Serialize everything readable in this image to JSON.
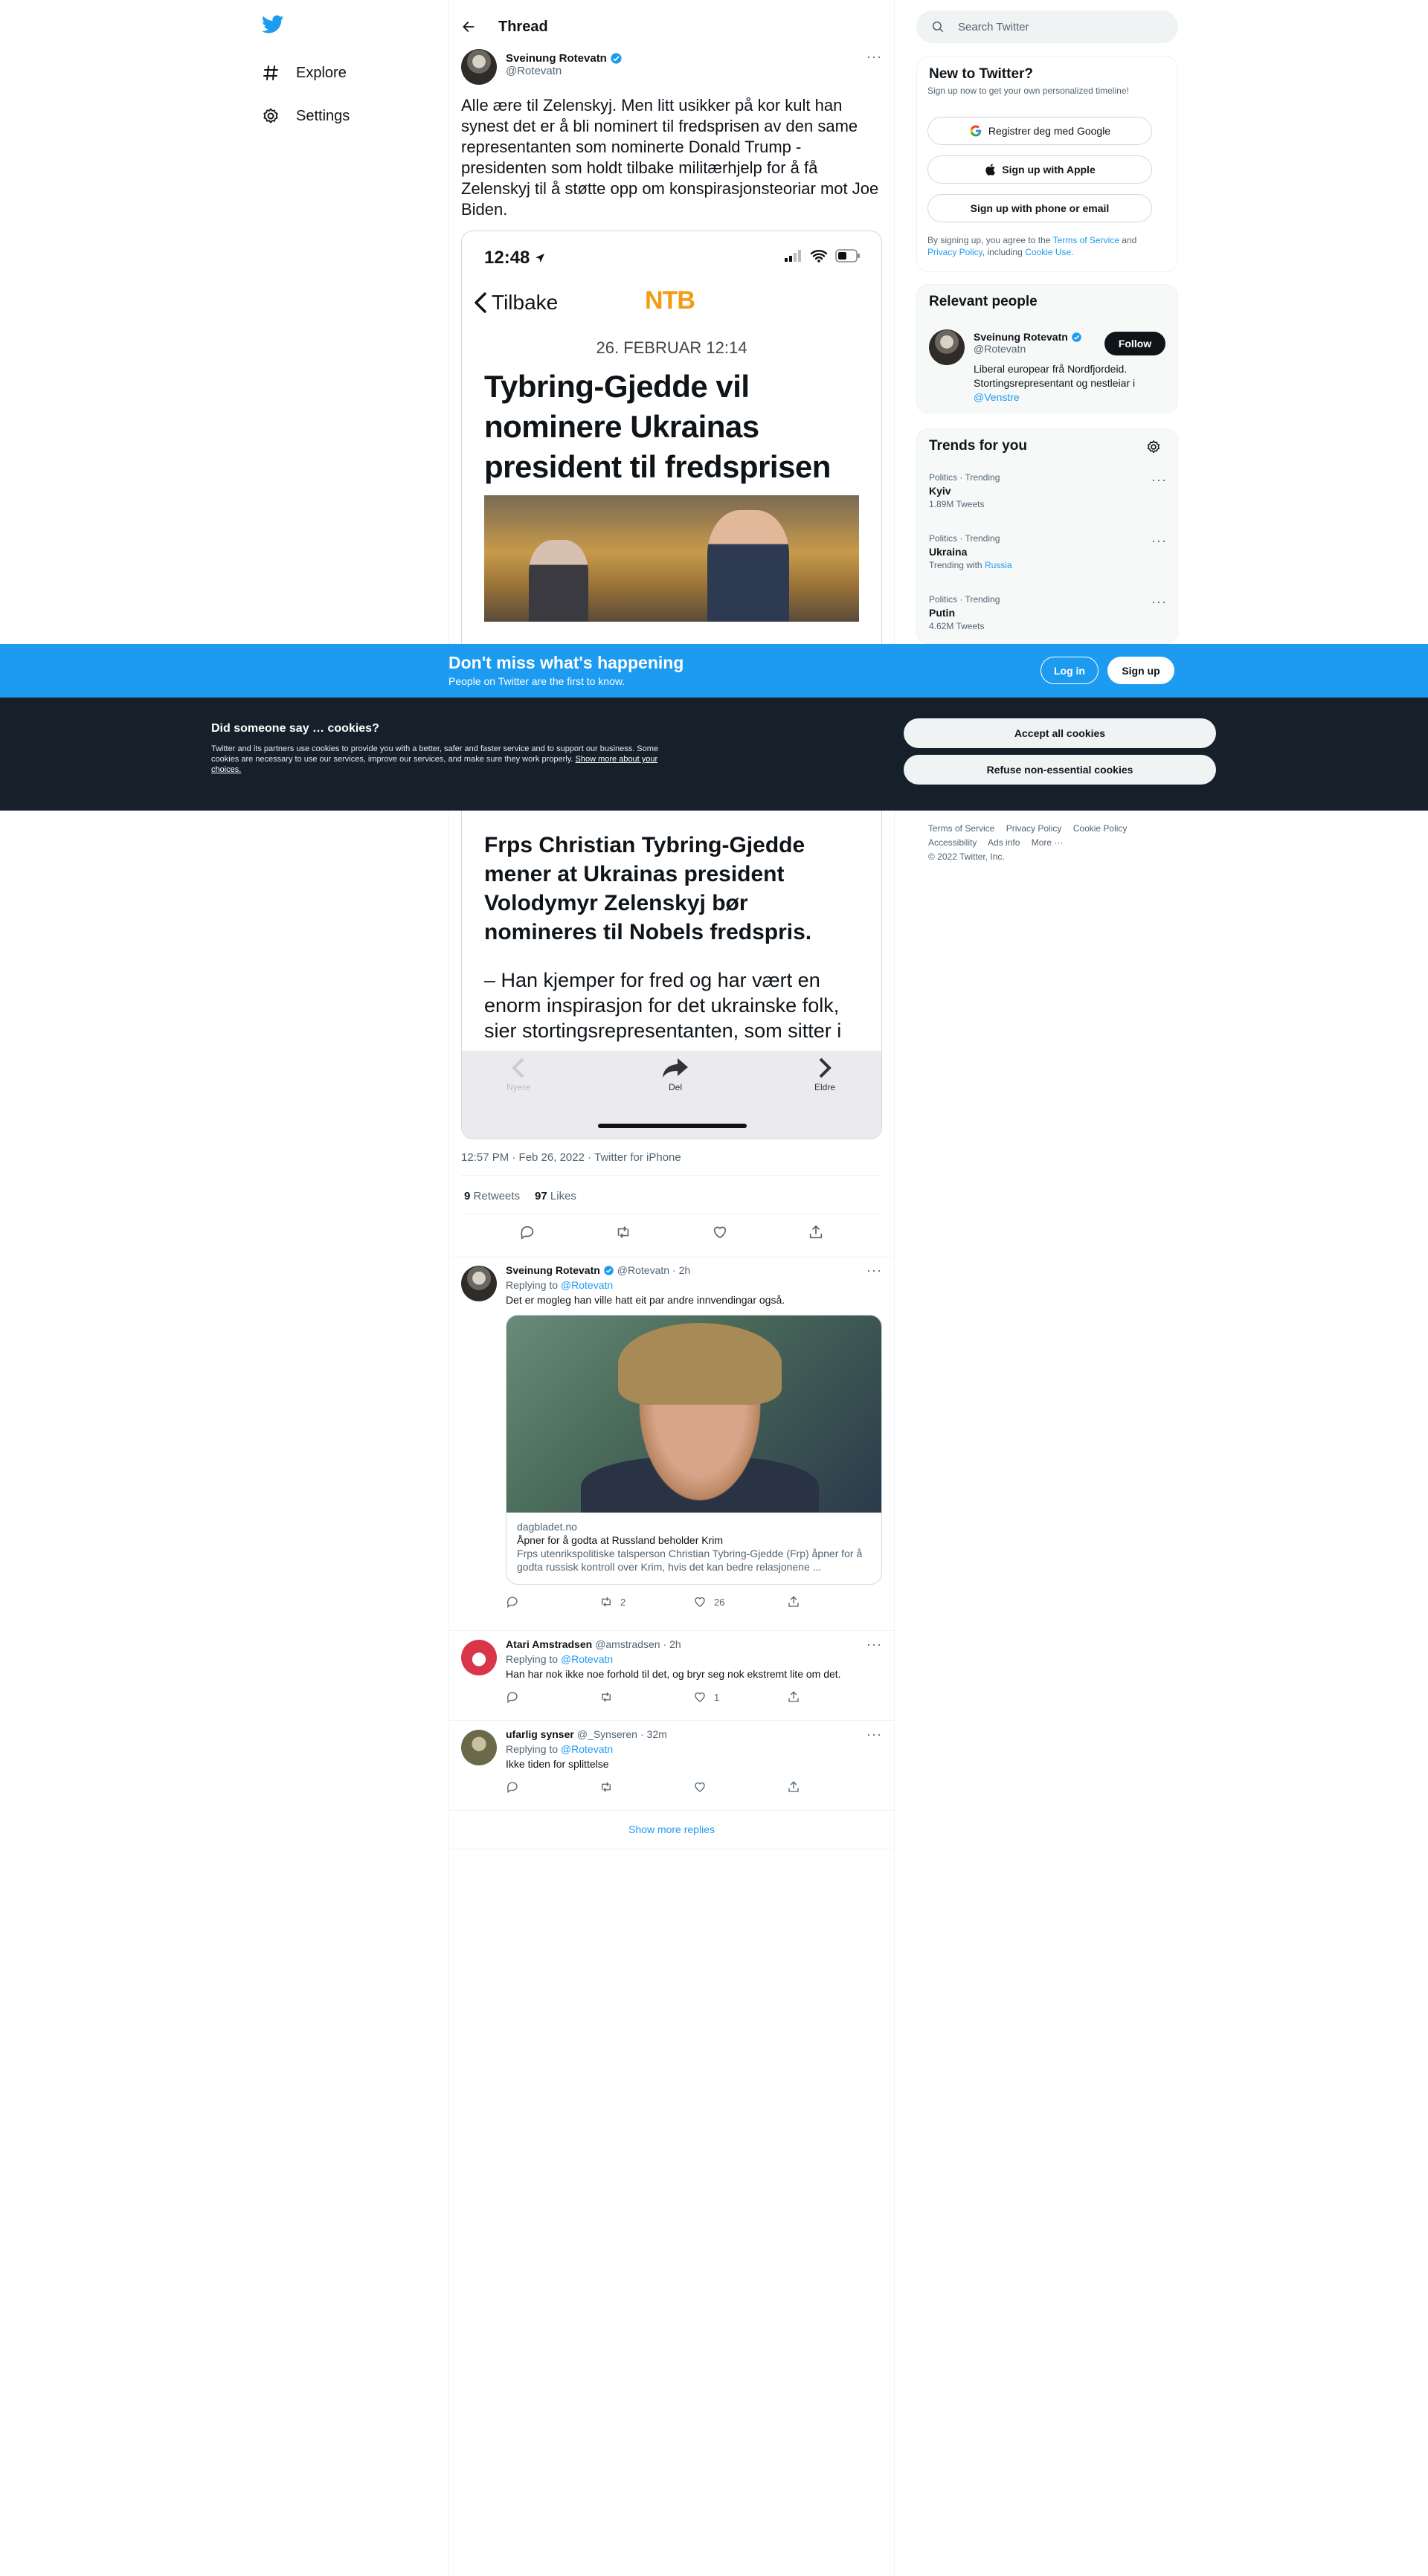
{
  "nav": {
    "explore": "Explore",
    "settings": "Settings"
  },
  "thread": {
    "header_title": "Thread",
    "author_name": "Sveinung Rotevatn",
    "author_handle": "@Rotevatn",
    "text": "Alle ære til Zelenskyj. Men litt usikker på kor kult han synest det er å bli nominert til fredsprisen av den same representanten som nominerte Donald Trump - presidenten som holdt tilbake militærhjelp for å få Zelenskyj til å støtte opp om konspirasjonsteoriar mot Joe Biden.",
    "meta": "12:57 PM · Feb 26, 2022 · Twitter for iPhone",
    "retweets": "9",
    "retweets_label": "Retweets",
    "likes": "97",
    "likes_label": "Likes"
  },
  "screenshot": {
    "time": "12:48",
    "back": "Tilbake",
    "brand": "NTB",
    "date": "26. FEBRUAR 12:14",
    "headline": "Tybring-Gjedde vil nominere Ukrainas president til fredsprisen",
    "lead": "Frps Christian Tybring-Gjedde mener at Ukrainas president Volodymyr Zelenskyj bør nomineres til Nobels fredspris.",
    "body": "– Han kjemper for fred og har vært en enorm inspirasjon for det ukrainske folk, sier stortingsrepresentanten, som sitter i",
    "nav_newer": "Nyere",
    "nav_share": "Del",
    "nav_older": "Eldre"
  },
  "replies": [
    {
      "name": "Sveinung Rotevatn",
      "handle": "@Rotevatn",
      "time": "· 2h",
      "replying_label": "Replying to",
      "replying_to": "@Rotevatn",
      "text": "Det er mogleg han ville hatt eit par andre innvendingar også.",
      "retweets": "2",
      "likes": "26",
      "card": {
        "domain": "dagbladet.no",
        "title": "Åpner for å godta at Russland beholder Krim",
        "desc": "Frps utenrikspolitiske talsperson Christian Tybring-Gjedde (Frp) åpner for å godta russisk kontroll over Krim, hvis det kan bedre relasjonene ..."
      }
    },
    {
      "name": "Atari Amstradsen",
      "handle": "@amstradsen",
      "time": "· 2h",
      "replying_label": "Replying to",
      "replying_to": "@Rotevatn",
      "text": "Han har nok ikke noe forhold til det, og bryr seg nok ekstremt lite om det.",
      "likes": "1"
    },
    {
      "name": "ufarlig synser",
      "handle": "@_Synseren",
      "time": "· 32m",
      "replying_label": "Replying to",
      "replying_to": "@Rotevatn",
      "text": "Ikke tiden for splittelse"
    }
  ],
  "show_more": "Show more replies",
  "sidebar": {
    "search_placeholder": "Search Twitter",
    "new_title": "New to Twitter?",
    "new_sub": "Sign up now to get your own personalized timeline!",
    "google": "Registrer deg med Google",
    "apple": "Sign up with Apple",
    "phone": "Sign up with phone or email",
    "terms_pre": "By signing up, you agree to the",
    "terms": "Terms of Service",
    "and": "and",
    "privacy": "Privacy Policy",
    "including": ", including",
    "cookie_use": "Cookie Use.",
    "relevant_title": "Relevant people",
    "person_name": "Sveinung Rotevatn",
    "person_handle": "@Rotevatn",
    "follow": "Follow",
    "person_bio": "Liberal europear frå Nordfjordeid. Stortingsrepresentant og nestleiar i",
    "person_bio_link": "@Venstre",
    "trends_title": "Trends for you",
    "trends": [
      {
        "cat": "Politics · Trending",
        "name": "Kyiv",
        "count": "1.89M Tweets"
      },
      {
        "cat": "Politics · Trending",
        "name": "Ukraina",
        "count": "Trending with",
        "with": "Russia"
      },
      {
        "cat": "Politics · Trending",
        "name": "Putin",
        "count": "4.62M Tweets"
      }
    ],
    "footer": {
      "tos": "Terms of Service",
      "privacy": "Privacy Policy",
      "cookie": "Cookie Policy",
      "access": "Accessibility",
      "ads": "Ads info",
      "more": "More ···",
      "copy": "© 2022 Twitter, Inc."
    }
  },
  "banner": {
    "title": "Don't miss what's happening",
    "sub": "People on Twitter are the first to know.",
    "login": "Log in",
    "signup": "Sign up"
  },
  "cookies": {
    "title": "Did someone say … cookies?",
    "body": "Twitter and its partners use cookies to provide you with a better, safer and faster service and to support our business. Some cookies are necessary to use our services, improve our services, and make sure they work properly.",
    "link": "Show more about your choices.",
    "accept": "Accept all cookies",
    "refuse": "Refuse non-essential cookies"
  },
  "colors": {
    "accent": "#1d9bf0",
    "dark": "#15202b",
    "ntb": "#f39c12"
  }
}
